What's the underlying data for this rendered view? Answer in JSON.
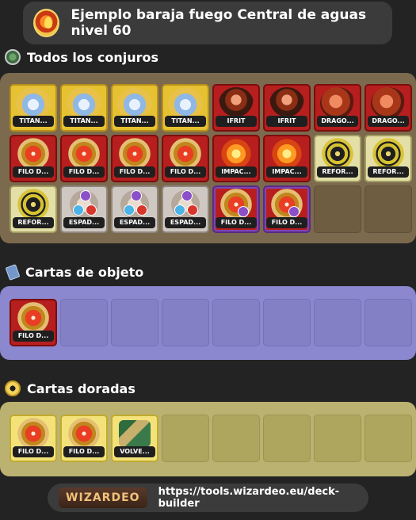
{
  "header": {
    "title": "Ejemplo baraja fuego Central de aguas nivel 60",
    "school_icon": "fire-school-icon"
  },
  "spells": {
    "heading": "Todos los conjuros",
    "icon": "spells-icon",
    "cards": [
      {
        "label": "TITAN...",
        "style": "gold",
        "art": "titan"
      },
      {
        "label": "TITAN...",
        "style": "gold",
        "art": "titan"
      },
      {
        "label": "TITAN...",
        "style": "gold",
        "art": "titan"
      },
      {
        "label": "TITAN...",
        "style": "gold",
        "art": "titan"
      },
      {
        "label": "IFRIT",
        "style": "red",
        "art": "ifrit"
      },
      {
        "label": "IFRIT",
        "style": "red",
        "art": "ifrit"
      },
      {
        "label": "DRAGO...",
        "style": "red",
        "art": "dragon"
      },
      {
        "label": "DRAGO...",
        "style": "red",
        "art": "dragon"
      },
      {
        "label": "FILO D...",
        "style": "red",
        "art": "filo"
      },
      {
        "label": "FILO D...",
        "style": "red",
        "art": "filo"
      },
      {
        "label": "FILO D...",
        "style": "red",
        "art": "filo"
      },
      {
        "label": "FILO D...",
        "style": "red",
        "art": "filo"
      },
      {
        "label": "IMPAC...",
        "style": "red",
        "art": "impact"
      },
      {
        "label": "IMPAC...",
        "style": "red",
        "art": "impact"
      },
      {
        "label": "REFOR...",
        "style": "cream",
        "art": "refor"
      },
      {
        "label": "REFOR...",
        "style": "cream",
        "art": "refor"
      },
      {
        "label": "REFOR...",
        "style": "cream",
        "art": "refor"
      },
      {
        "label": "ESPAD...",
        "style": "silver",
        "art": "espada"
      },
      {
        "label": "ESPAD...",
        "style": "silver",
        "art": "espada"
      },
      {
        "label": "ESPAD...",
        "style": "silver",
        "art": "espada"
      },
      {
        "label": "FILO D...",
        "style": "lilac",
        "art": "filo"
      },
      {
        "label": "FILO D...",
        "style": "lilac",
        "art": "filo"
      }
    ],
    "total_slots": 24
  },
  "items": {
    "heading": "Cartas de objeto",
    "icon": "item-cards-icon",
    "cards": [
      {
        "label": "FILO D...",
        "style": "red",
        "art": "filo"
      }
    ],
    "total_slots": 8
  },
  "gold": {
    "heading": "Cartas doradas",
    "icon": "gold-cards-icon",
    "cards": [
      {
        "label": "FILO D...",
        "style": "paleyel",
        "art": "filo"
      },
      {
        "label": "FILO D...",
        "style": "paleyel",
        "art": "filo"
      },
      {
        "label": "VOLVE...",
        "style": "paleyel",
        "art": "volve"
      }
    ],
    "total_slots": 8
  },
  "footer": {
    "logo_text": "WIZARDEO",
    "url": "https://tools.wizardeo.eu/deck-builder"
  },
  "colors": {
    "background": "#232323",
    "spells_panel": "#7b6a4d",
    "items_panel": "#8b88cf",
    "gold_panel": "#bbb272"
  }
}
